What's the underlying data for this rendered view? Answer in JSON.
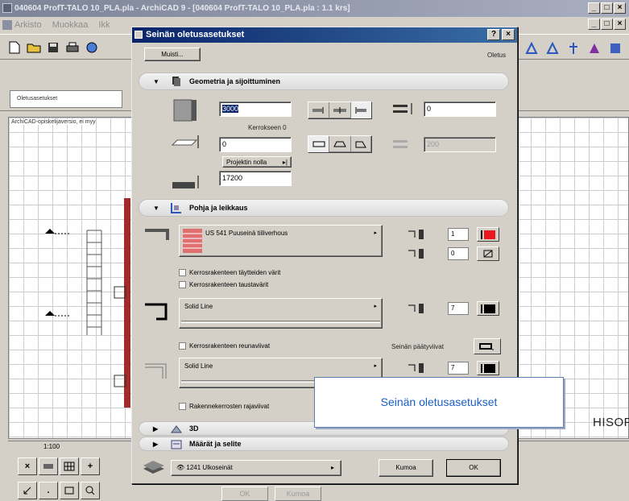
{
  "app": {
    "title": "040604 ProfT-TALO 10_PLA.pla - ArchiCAD 9 - [040604 ProfT-TALO 10_PLA.pla : 1.1 krs]",
    "menu": [
      "Arkisto",
      "Muokkaa",
      "Ikk"
    ],
    "tab_label": "Oletusasetukset",
    "canvas_note": "ArchiCAD-opiskelijaversio, ei myy",
    "brand": "HISOFT.",
    "status_scale": "1:100",
    "ghost_buttons": [
      "OK",
      "Kumoa"
    ],
    "window_controls": [
      "_",
      "□",
      "×"
    ]
  },
  "dialog": {
    "title": "Seinän oletusasetukset",
    "title_help": "?",
    "title_close": "×",
    "favorites_button": "Muisti...",
    "defaults_label": "Oletus",
    "geometry": {
      "header": "Geometria ja sijoittuminen",
      "height_value": "3000",
      "story_label": "Kerrokseen 0",
      "base_offset_value": "0",
      "ref_label": "Projektin nolla",
      "ref_arrow": "▸|",
      "elevation_value": "17200",
      "thickness_value": "0",
      "disabled_value": "200"
    },
    "plan_section": {
      "header": "Pohja ja leikkaus",
      "material_label": "US 541 Puuseinä tiiliverhous",
      "pen1_value": "1",
      "pen2_value": "0",
      "fill_colors_check": "Kerrosrakenteen täytteiden värit",
      "fill_bg_check": "Kerrosrakenteen taustavärit",
      "line1_label": "Solid Line",
      "line1_pen": "7",
      "outline_check": "Kerrosrakenteen reunaviivat",
      "end_lines_label": "Seinän päätyviivat",
      "line2_label": "Solid Line",
      "line2_pen": "7",
      "boundary_check": "Rakennekerrosten rajaviivat"
    },
    "collapsed_panels": [
      "3D",
      "Määrät ja selite"
    ],
    "layer_label": "1241 Ulkoseinät",
    "cancel_button": "Kumoa",
    "ok_button": "OK"
  },
  "tooltip": {
    "text": "Seinän oletusasetukset"
  },
  "colors": {
    "dialog_title": "#0a246a",
    "tooltip_text": "#1b5fc4",
    "wall_red": "#a32a2a",
    "pen_red": "#e8181e"
  }
}
